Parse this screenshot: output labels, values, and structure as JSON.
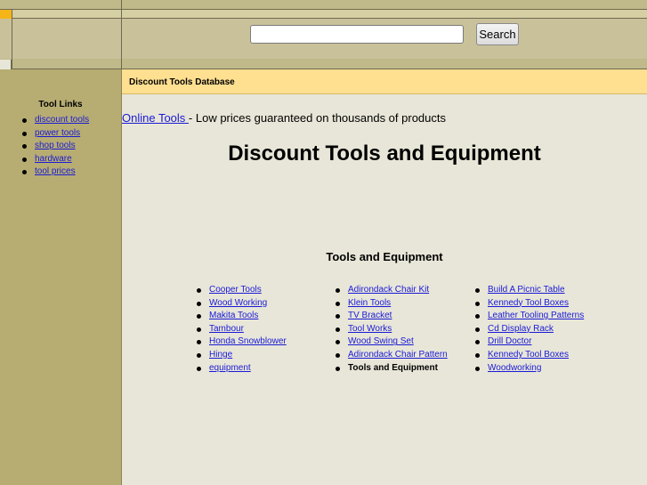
{
  "search": {
    "placeholder": "",
    "value": "",
    "button_label": "Search"
  },
  "sidebar": {
    "title": "Tool Links",
    "items": [
      "discount tools",
      "power tools",
      "shop tools",
      "hardware",
      "tool prices"
    ]
  },
  "banner": {
    "title": "Discount Tools Database"
  },
  "promo": {
    "link_text": "Online Tools ",
    "text": " - Low prices guaranteed on thousands of products"
  },
  "main": {
    "heading": "Discount Tools and Equipment",
    "section_heading": "Tools and Equipment",
    "columns": [
      [
        {
          "label": "Cooper Tools ",
          "link": true
        },
        {
          "label": "Wood Working ",
          "link": true
        },
        {
          "label": "Makita Tools ",
          "link": true
        },
        {
          "label": "Tambour",
          "link": true
        },
        {
          "label": "Honda Snowblower",
          "link": true
        },
        {
          "label": "Hinge ",
          "link": true
        },
        {
          "label": "equipment",
          "link": true
        }
      ],
      [
        {
          "label": "Adirondack Chair Kit",
          "link": true
        },
        {
          "label": "Klein Tools ",
          "link": true
        },
        {
          "label": "TV Bracket",
          "link": true
        },
        {
          "label": "Tool Works",
          "link": true
        },
        {
          "label": "Wood Swing Set",
          "link": true
        },
        {
          "label": "Adirondack Chair Pattern",
          "link": true
        },
        {
          "label": "Tools and Equipment",
          "link": false
        }
      ],
      [
        {
          "label": "Build A Picnic Table",
          "link": true
        },
        {
          "label": "Kennedy Tool Boxes",
          "link": true
        },
        {
          "label": "Leather Tooling Patterns",
          "link": true
        },
        {
          "label": "Cd Display Rack",
          "link": true
        },
        {
          "label": "Drill Doctor",
          "link": true
        },
        {
          "label": "Kennedy Tool Boxes ",
          "link": true
        },
        {
          "label": "Woodworking",
          "link": true
        }
      ]
    ]
  },
  "colors": {
    "banner": "#ffdf90",
    "sidebar": "#b7ad72",
    "link": "#1a1ad6",
    "accent": "#f5b518"
  }
}
